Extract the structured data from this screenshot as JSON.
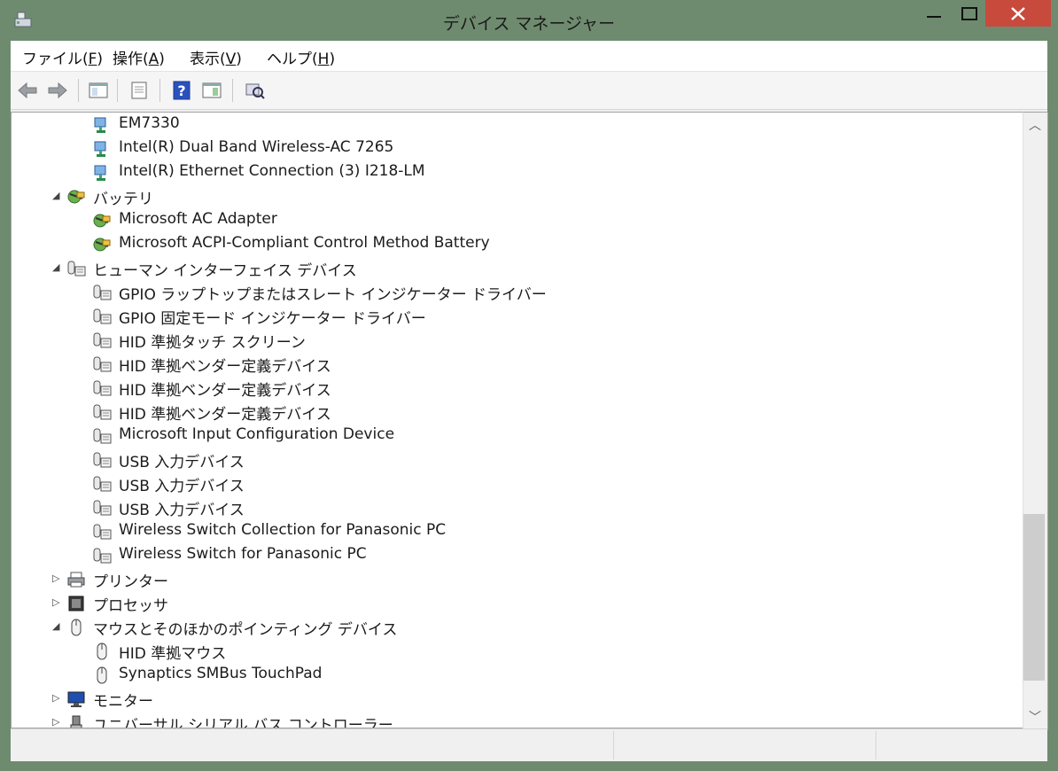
{
  "window": {
    "title": "デバイス マネージャー"
  },
  "menu": [
    {
      "label": "ファイル(",
      "key": "F",
      "tail": ")"
    },
    {
      "label": "操作(",
      "key": "A",
      "tail": ")"
    },
    {
      "label": "表示(",
      "key": "V",
      "tail": ")"
    },
    {
      "label": "ヘルプ(",
      "key": "H",
      "tail": ")"
    }
  ],
  "toolbar": [
    "back-icon",
    "forward-icon",
    "show-hide-tree-icon",
    "properties-icon",
    "help-icon",
    "update-driver-icon",
    "scan-hardware-icon"
  ],
  "tree": {
    "items": [
      {
        "label": "EM7330",
        "icon": "network-adapter-icon",
        "level": 2
      },
      {
        "label": "Intel(R) Dual Band Wireless-AC 7265",
        "icon": "network-adapter-icon",
        "level": 2
      },
      {
        "label": "Intel(R) Ethernet Connection (3) I218-LM",
        "icon": "network-adapter-icon",
        "level": 2
      },
      {
        "label": "バッテリ",
        "icon": "battery-icon",
        "level": 1,
        "expanded": true
      },
      {
        "label": "Microsoft AC Adapter",
        "icon": "battery-icon",
        "level": 2
      },
      {
        "label": "Microsoft ACPI-Compliant Control Method Battery",
        "icon": "battery-icon",
        "level": 2
      },
      {
        "label": "ヒューマン インターフェイス デバイス",
        "icon": "hid-icon",
        "level": 1,
        "expanded": true
      },
      {
        "label": "GPIO ラップトップまたはスレート インジケーター ドライバー",
        "icon": "hid-icon",
        "level": 2
      },
      {
        "label": "GPIO 固定モード インジケーター ドライバー",
        "icon": "hid-icon",
        "level": 2
      },
      {
        "label": "HID 準拠タッチ スクリーン",
        "icon": "hid-icon",
        "level": 2
      },
      {
        "label": "HID 準拠ベンダー定義デバイス",
        "icon": "hid-icon",
        "level": 2
      },
      {
        "label": "HID 準拠ベンダー定義デバイス",
        "icon": "hid-icon",
        "level": 2
      },
      {
        "label": "HID 準拠ベンダー定義デバイス",
        "icon": "hid-icon",
        "level": 2
      },
      {
        "label": "Microsoft Input Configuration Device",
        "icon": "hid-icon",
        "level": 2
      },
      {
        "label": "USB 入力デバイス",
        "icon": "hid-icon",
        "level": 2
      },
      {
        "label": "USB 入力デバイス",
        "icon": "hid-icon",
        "level": 2
      },
      {
        "label": "USB 入力デバイス",
        "icon": "hid-icon",
        "level": 2
      },
      {
        "label": "Wireless Switch Collection for Panasonic PC",
        "icon": "hid-icon",
        "level": 2
      },
      {
        "label": "Wireless Switch for Panasonic PC",
        "icon": "hid-icon",
        "level": 2
      },
      {
        "label": "プリンター",
        "icon": "printer-icon",
        "level": 1,
        "expanded": false
      },
      {
        "label": "プロセッサ",
        "icon": "processor-icon",
        "level": 1,
        "expanded": false
      },
      {
        "label": "マウスとそのほかのポインティング デバイス",
        "icon": "mouse-icon",
        "level": 1,
        "expanded": true
      },
      {
        "label": "HID 準拠マウス",
        "icon": "mouse-icon",
        "level": 2
      },
      {
        "label": "Synaptics SMBus TouchPad",
        "icon": "mouse-icon",
        "level": 2
      },
      {
        "label": "モニター",
        "icon": "monitor-icon",
        "level": 1,
        "expanded": false
      },
      {
        "label": "ユニバーサル シリアル バス コントローラー",
        "icon": "usb-icon",
        "level": 1,
        "expanded": false
      }
    ]
  },
  "colors": {
    "title_bg": "#6f8b6f",
    "close_btn": "#c74a3d"
  }
}
